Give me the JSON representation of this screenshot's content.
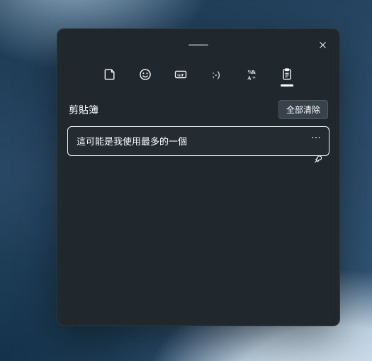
{
  "panel": {
    "tabs": {
      "kaomoji_label": ";-)",
      "symbols_label": "%&"
    },
    "section": {
      "title": "剪貼簿",
      "clear_all": "全部清除"
    },
    "clips": [
      {
        "text": "這可能是我使用最多的一個"
      }
    ]
  }
}
